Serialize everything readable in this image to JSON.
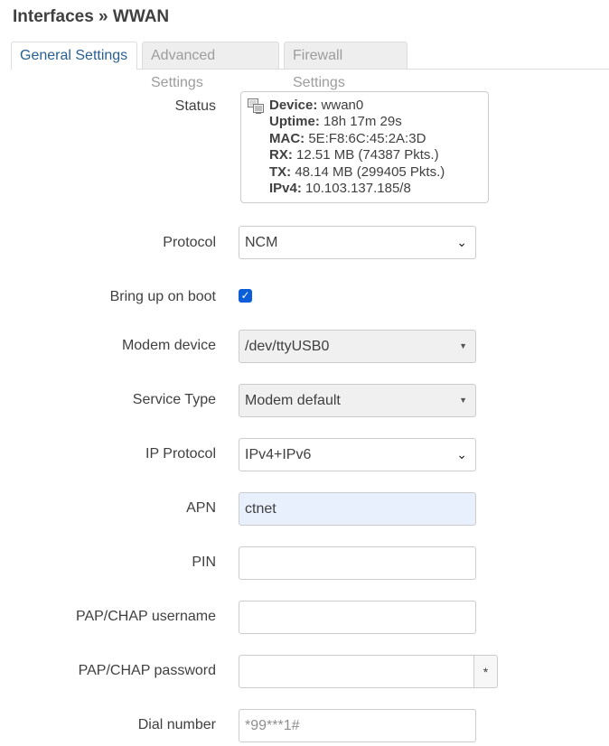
{
  "page": {
    "title": "Interfaces » WWAN"
  },
  "tabs": [
    {
      "label": "General Settings",
      "active": true
    },
    {
      "label": "Advanced Settings",
      "active": false
    },
    {
      "label": "Firewall Settings",
      "active": false
    }
  ],
  "status": {
    "label": "Status",
    "icon": "network-interface-icon",
    "lines": [
      {
        "key": "Device:",
        "value": "wwan0"
      },
      {
        "key": "Uptime:",
        "value": "18h 17m 29s"
      },
      {
        "key": "MAC:",
        "value": "5E:F8:6C:45:2A:3D"
      },
      {
        "key": "RX:",
        "value": "12.51 MB (74387 Pkts.)"
      },
      {
        "key": "TX:",
        "value": "48.14 MB (299405 Pkts.)"
      },
      {
        "key": "IPv4:",
        "value": "10.103.137.185/8"
      }
    ]
  },
  "fields": {
    "protocol": {
      "label": "Protocol",
      "value": "NCM"
    },
    "bring_up_on_boot": {
      "label": "Bring up on boot",
      "checked": true
    },
    "modem_device": {
      "label": "Modem device",
      "value": "/dev/ttyUSB0"
    },
    "service_type": {
      "label": "Service Type",
      "value": "Modem default"
    },
    "ip_protocol": {
      "label": "IP Protocol",
      "value": "IPv4+IPv6"
    },
    "apn": {
      "label": "APN",
      "value": "ctnet"
    },
    "pin": {
      "label": "PIN",
      "value": ""
    },
    "pap_chap_username": {
      "label": "PAP/CHAP username",
      "value": ""
    },
    "pap_chap_password": {
      "label": "PAP/CHAP password",
      "value": "",
      "reveal_label": "*"
    },
    "dial_number": {
      "label": "Dial number",
      "value": "",
      "placeholder": "*99***1#"
    }
  },
  "colors": {
    "accent": "#286090",
    "checkbox": "#0b5ed7",
    "autofill": "#e8f0fe"
  }
}
